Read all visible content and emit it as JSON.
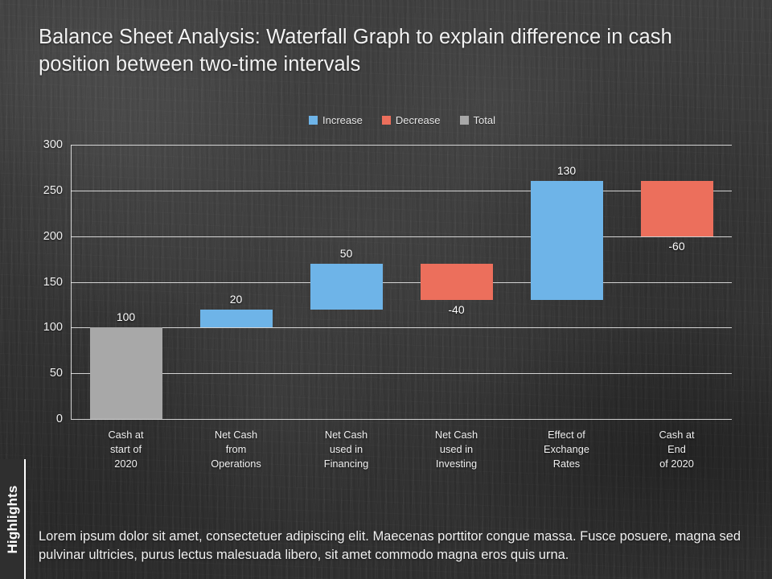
{
  "slide": {
    "title": "Balance Sheet Analysis: Waterfall Graph to explain difference in cash position between two-time intervals",
    "sidebar_tab_label": "Highlights",
    "footer_text": "Lorem ipsum dolor sit amet, consectetuer adipiscing elit. Maecenas porttitor congue massa. Fusce posuere, magna sed pulvinar ultricies, purus lectus malesuada libero, sit amet commodo magna eros quis urna."
  },
  "colors": {
    "increase": "#6EB4E8",
    "decrease": "#EC6F5C",
    "total": "#A8A8A8",
    "background": "#363636",
    "gridline": "#F5F5F5",
    "text": "#F0F0F0"
  },
  "chart_data": {
    "type": "bar",
    "subtype": "waterfall",
    "title": "",
    "xlabel": "",
    "ylabel": "",
    "ylim": [
      0,
      300
    ],
    "yticks": [
      300,
      250,
      200,
      150,
      100,
      50,
      0
    ],
    "grid": true,
    "legend_position": "top-center",
    "legend": [
      {
        "label": "Increase",
        "color": "#6EB4E8"
      },
      {
        "label": "Decrease",
        "color": "#EC6F5C"
      },
      {
        "label": "Total",
        "color": "#A8A8A8"
      }
    ],
    "categories": [
      "Cash at start of 2020",
      "Net Cash from Operations",
      "Net Cash used in Financing",
      "Net Cash used in Investing",
      "Effect of Exchange Rates",
      "Cash at End of 2020"
    ],
    "category_lines": [
      [
        "Cash at",
        "start of",
        "2020"
      ],
      [
        "Net Cash",
        "from",
        "Operations"
      ],
      [
        "Net Cash",
        "used in",
        "Financing"
      ],
      [
        "Net Cash",
        "used in",
        "Investing"
      ],
      [
        "Effect of",
        "Exchange",
        "Rates"
      ],
      [
        "Cash at",
        "End",
        "of 2020"
      ]
    ],
    "values": [
      100,
      20,
      50,
      -40,
      130,
      -60
    ],
    "value_labels": [
      "100",
      "20",
      "50",
      "-40",
      "130",
      "-60"
    ],
    "types": [
      "total",
      "increase",
      "increase",
      "decrease",
      "increase",
      "decrease"
    ],
    "bars": [
      {
        "label": "100",
        "base": 0,
        "top": 100,
        "type": "total",
        "label_side": "above"
      },
      {
        "label": "20",
        "base": 100,
        "top": 120,
        "type": "increase",
        "label_side": "above"
      },
      {
        "label": "50",
        "base": 120,
        "top": 170,
        "type": "increase",
        "label_side": "above"
      },
      {
        "label": "-40",
        "base": 170,
        "top": 130,
        "type": "decrease",
        "label_side": "below"
      },
      {
        "label": "130",
        "base": 130,
        "top": 260,
        "type": "increase",
        "label_side": "above"
      },
      {
        "label": "-60",
        "base": 260,
        "top": 200,
        "type": "decrease",
        "label_side": "below"
      }
    ]
  }
}
